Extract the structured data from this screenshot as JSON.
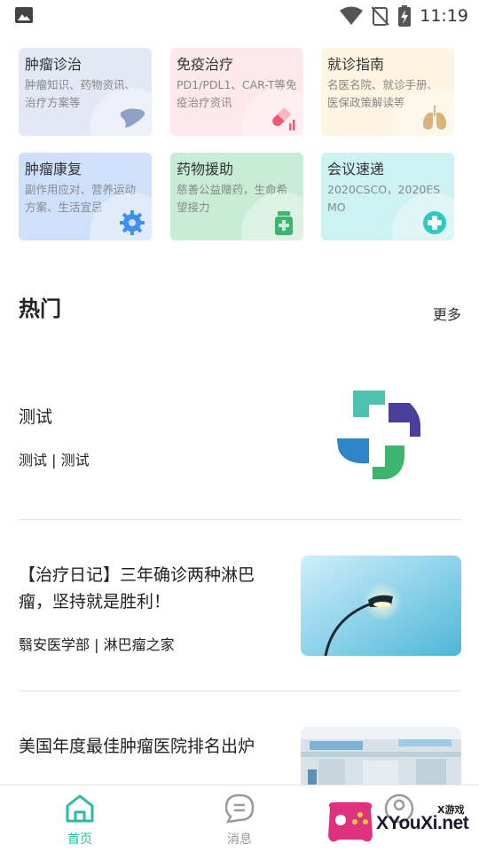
{
  "status_bar": {
    "time": "11:19"
  },
  "categories": [
    {
      "title": "肿瘤诊治",
      "desc": "肿瘤知识、药物资讯、治疗方案等",
      "bg": "#e3e8f5",
      "icon": "liver-icon"
    },
    {
      "title": "免疫治疗",
      "desc": "PD1/PDL1、CAR-T等免疫治疗资讯",
      "bg": "#fde9ec",
      "icon": "capsule-icon"
    },
    {
      "title": "就诊指南",
      "desc": "名医名院、就诊手册、医保政策解读等",
      "bg": "#fdf4e1",
      "icon": "lungs-icon"
    },
    {
      "title": "肿瘤康复",
      "desc": "副作用应对、营养运动方案、生活宜忌",
      "bg": "#cfe0fb",
      "icon": "gear-icon"
    },
    {
      "title": "药物援助",
      "desc": "慈善公益赠药，生命希望接力",
      "bg": "#c9ecd6",
      "icon": "medicine-bottle-icon"
    },
    {
      "title": "会议速递",
      "desc": "2020CSCO，2020ESMO",
      "bg": "#ccf3f1",
      "icon": "plus-circle-icon"
    }
  ],
  "hot": {
    "title": "热门",
    "more": "更多"
  },
  "articles": [
    {
      "title": "测试",
      "meta": "测试 | 测试"
    },
    {
      "title": "【治疗日记】三年确诊两种淋巴瘤，坚持就是胜利！",
      "meta": "翳安医学部 | 淋巴瘤之家"
    },
    {
      "title": "美国年度最佳肿瘤医院排名出炉",
      "meta": ""
    }
  ],
  "nav": {
    "home": "首页",
    "messages": "消息"
  },
  "watermark": {
    "text": "XYouXi.net",
    "sub": "X游戏"
  },
  "colors": {
    "accent": "#2bbaa5"
  }
}
